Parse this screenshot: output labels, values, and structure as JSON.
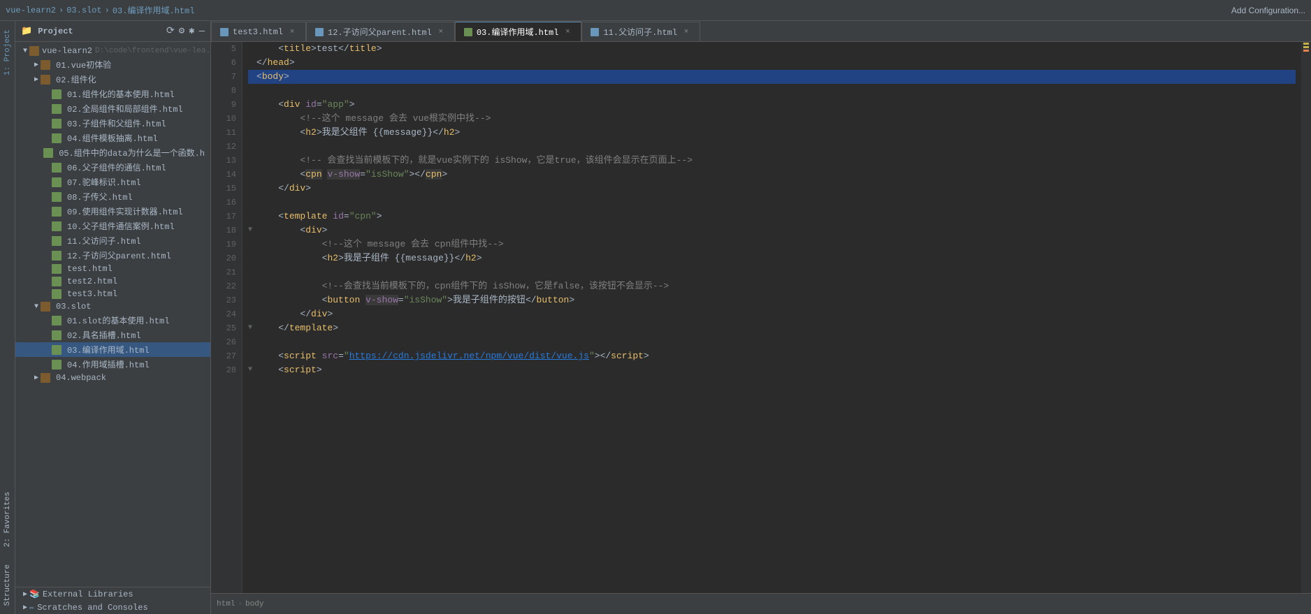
{
  "topbar": {
    "breadcrumb": [
      "vue-learn2",
      "03.slot",
      "03.编译作用域.html"
    ],
    "add_config": "Add Configuration..."
  },
  "tabs": [
    {
      "id": "test3",
      "label": "test3.html",
      "active": false,
      "color": "blue"
    },
    {
      "id": "12child",
      "label": "12.子访问父parent.html",
      "active": false,
      "color": "blue"
    },
    {
      "id": "03compile",
      "label": "03.编译作用域.html",
      "active": true,
      "color": "green"
    },
    {
      "id": "11father",
      "label": "11.父访问子.html",
      "active": false,
      "color": "blue"
    }
  ],
  "sidebar": {
    "title": "Project",
    "root": "vue-learn2",
    "root_path": "D:\\code\\frontend\\vue-lea..."
  },
  "tree_items": [
    {
      "level": 1,
      "type": "folder",
      "label": "01.vue初体验",
      "open": false
    },
    {
      "level": 1,
      "type": "folder",
      "label": "02.组件化",
      "open": false
    },
    {
      "level": 2,
      "type": "file",
      "label": "01.组件化的基本使用.html"
    },
    {
      "level": 2,
      "type": "file",
      "label": "02.全局组件和局部组件.html"
    },
    {
      "level": 2,
      "type": "file",
      "label": "03.子组件和父组件.html"
    },
    {
      "level": 2,
      "type": "file",
      "label": "04.组件模板抽离.html"
    },
    {
      "level": 2,
      "type": "file",
      "label": "05.组件中的data为什么是一个函数.h"
    },
    {
      "level": 2,
      "type": "file",
      "label": "06.父子组件的通信.html"
    },
    {
      "level": 2,
      "type": "file",
      "label": "07.驼峰标识.html"
    },
    {
      "level": 2,
      "type": "file",
      "label": "08.子传父.html"
    },
    {
      "level": 2,
      "type": "file",
      "label": "09.使用组件实现计数器.html"
    },
    {
      "level": 2,
      "type": "file",
      "label": "10.父子组件通信案例.html"
    },
    {
      "level": 2,
      "type": "file",
      "label": "11.父访问子.html"
    },
    {
      "level": 2,
      "type": "file",
      "label": "12.子访问父parent.html"
    },
    {
      "level": 2,
      "type": "file",
      "label": "test.html"
    },
    {
      "level": 2,
      "type": "file",
      "label": "test2.html"
    },
    {
      "level": 2,
      "type": "file",
      "label": "test3.html"
    },
    {
      "level": 1,
      "type": "folder",
      "label": "03.slot",
      "open": true
    },
    {
      "level": 2,
      "type": "file",
      "label": "01.slot的基本使用.html"
    },
    {
      "level": 2,
      "type": "file",
      "label": "02.具名插槽.html"
    },
    {
      "level": 2,
      "type": "file",
      "label": "03.编译作用域.html",
      "selected": true
    },
    {
      "level": 2,
      "type": "file",
      "label": "04.作用域插槽.html"
    },
    {
      "level": 1,
      "type": "folder",
      "label": "04.webpack",
      "open": false
    },
    {
      "level": 0,
      "type": "special",
      "label": "External Libraries"
    },
    {
      "level": 0,
      "type": "special",
      "label": "Scratches and Consoles"
    }
  ],
  "code_lines": [
    {
      "num": 5,
      "content": "    <title>test</title>",
      "fold": false
    },
    {
      "num": 6,
      "content": "</head>",
      "fold": false
    },
    {
      "num": 7,
      "content": "<body>",
      "fold": false,
      "highlight": true
    },
    {
      "num": 8,
      "content": "",
      "fold": false
    },
    {
      "num": 9,
      "content": "    <div id=\"app\">",
      "fold": false
    },
    {
      "num": 10,
      "content": "        <!--这个 message 会去 vue根实例中找-->",
      "fold": false
    },
    {
      "num": 11,
      "content": "        <h2>我是父组件 {{message}}</h2>",
      "fold": false
    },
    {
      "num": 12,
      "content": "",
      "fold": false
    },
    {
      "num": 13,
      "content": "        <!-- 会查找当前模板下的，就是vue实例下的 isShow，它是true，该组件会显示在页面上-->",
      "fold": false
    },
    {
      "num": 14,
      "content": "        <cpn v-show=\"isShow\"></cpn>",
      "fold": false
    },
    {
      "num": 15,
      "content": "    </div>",
      "fold": false
    },
    {
      "num": 16,
      "content": "",
      "fold": false
    },
    {
      "num": 17,
      "content": "    <template id=\"cpn\">",
      "fold": false
    },
    {
      "num": 18,
      "content": "        <div>",
      "fold": true
    },
    {
      "num": 19,
      "content": "            <!--这个 message 会去 cpn组件中找-->",
      "fold": false
    },
    {
      "num": 20,
      "content": "            <h2>我是子组件 {{message}}</h2>",
      "fold": false
    },
    {
      "num": 21,
      "content": "",
      "fold": false
    },
    {
      "num": 22,
      "content": "            <!--会查找当前模板下的，cpn组件下的 isShow，它是false，该按钮不会显示-->",
      "fold": false
    },
    {
      "num": 23,
      "content": "            <button v-show=\"isShow\">我是子组件的按钮</button>",
      "fold": false
    },
    {
      "num": 24,
      "content": "        </div>",
      "fold": false
    },
    {
      "num": 25,
      "content": "    </template>",
      "fold": true
    },
    {
      "num": 26,
      "content": "",
      "fold": false
    },
    {
      "num": 27,
      "content": "    <script src=\"https://cdn.jsdelivr.net/npm/vue/dist/vue.js\"><\\/script>",
      "fold": false
    },
    {
      "num": 28,
      "content": "    <script>",
      "fold": true
    }
  ],
  "bottom": {
    "breadcrumb": [
      "html",
      "body"
    ]
  },
  "vertical_tabs": [
    "1: Project",
    "2: Favorites"
  ],
  "favorites_label": "2: Favorites",
  "structure_label": "Structure"
}
